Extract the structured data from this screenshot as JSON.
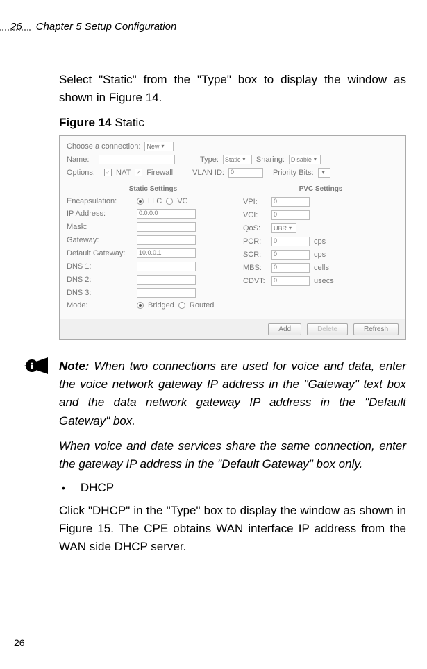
{
  "header": {
    "page_number_top": "26",
    "chapter_title": "Chapter 5 Setup Configuration"
  },
  "intro_para": "Select \"Static\" from the \"Type\" box to display the window as shown in Figure 14.",
  "figure_label_bold": "Figure 14",
  "figure_label_rest": " Static",
  "figure": {
    "choose_label": "Choose a connection:",
    "choose_value": "New",
    "name_label": "Name:",
    "type_label": "Type:",
    "type_value": "Static",
    "sharing_label": "Sharing:",
    "sharing_value": "Disable",
    "options_label": "Options:",
    "opt_nat": "NAT",
    "opt_firewall": "Firewall",
    "vlan_label": "VLAN ID:",
    "vlan_value": "0",
    "priority_label": "Priority Bits:",
    "static_title": "Static Settings",
    "pvc_title": "PVC Settings",
    "encap_label": "Encapsulation:",
    "encap_llc": "LLC",
    "encap_vc": "VC",
    "ip_label": "IP Address:",
    "ip_value": "0.0.0.0",
    "mask_label": "Mask:",
    "gateway_label": "Gateway:",
    "def_gw_label": "Default Gateway:",
    "def_gw_value": "10.0.0.1",
    "dns1_label": "DNS 1:",
    "dns2_label": "DNS 2:",
    "dns3_label": "DNS 3:",
    "mode_label": "Mode:",
    "mode_bridged": "Bridged",
    "mode_routed": "Routed",
    "vpi_label": "VPI:",
    "vpi_value": "0",
    "vci_label": "VCI:",
    "vci_value": "0",
    "qos_label": "QoS:",
    "qos_value": "UBR",
    "pcr_label": "PCR:",
    "pcr_value": "0",
    "pcr_unit": "cps",
    "scr_label": "SCR:",
    "scr_value": "0",
    "scr_unit": "cps",
    "mbs_label": "MBS:",
    "mbs_value": "0",
    "mbs_unit": "cells",
    "cdvt_label": "CDVT:",
    "cdvt_value": "0",
    "cdvt_unit": "usecs",
    "btn_add": "Add",
    "btn_delete": "Delete",
    "btn_refresh": "Refresh"
  },
  "note_label": "Note:",
  "note1": " When two connections are used for voice and data, enter the voice network gateway IP address in the \"Gateway\" text box and the data network gateway IP address in the \"Default Gateway\" box.",
  "note2": "When voice and date services share the same connection, enter the gateway IP address in the \"Default Gateway\" box only.",
  "bullet_item": "DHCP",
  "dhcp_para": "Click \"DHCP\" in the \"Type\" box to display the window as shown in Figure 15. The CPE obtains WAN interface IP address from the WAN side DHCP server.",
  "page_number_bottom": "26"
}
